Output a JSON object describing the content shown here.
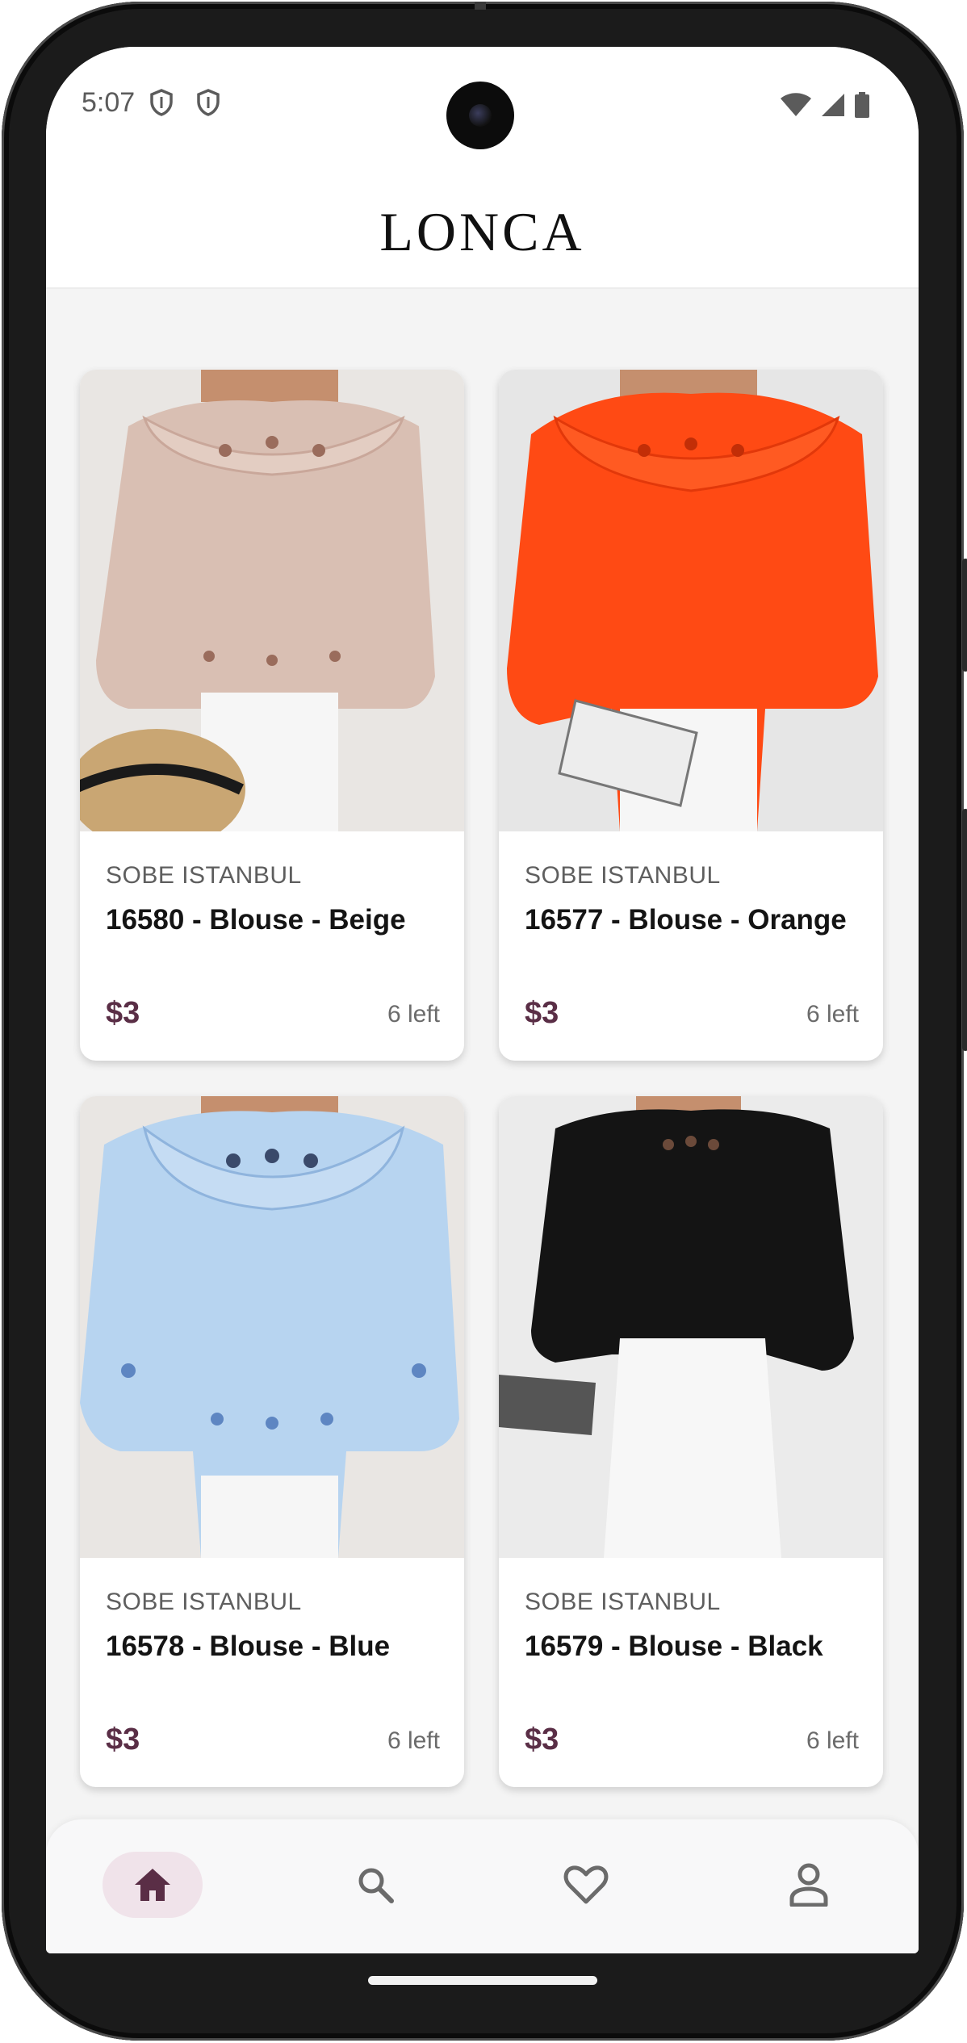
{
  "status_bar": {
    "time": "5:07",
    "icons": [
      "shield-icon",
      "shield-icon",
      "wifi-icon",
      "cellular-icon",
      "battery-icon"
    ]
  },
  "header": {
    "logo": "LONCA"
  },
  "products": [
    {
      "brand": "SOBE ISTANBUL",
      "title": "16580 - Blouse - Beige",
      "price": "$3",
      "stock": "6 left",
      "color": "#d9bfb3"
    },
    {
      "brand": "SOBE ISTANBUL",
      "title": "16577 - Blouse - Orange",
      "price": "$3",
      "stock": "6 left",
      "color": "#ff4a14"
    },
    {
      "brand": "SOBE ISTANBUL",
      "title": "16578 - Blouse - Blue",
      "price": "$3",
      "stock": "6 left",
      "color": "#b7d4f0"
    },
    {
      "brand": "SOBE ISTANBUL",
      "title": "16579 - Blouse - Black",
      "price": "$3",
      "stock": "6 left",
      "color": "#141414"
    }
  ],
  "bottom_nav": {
    "items": [
      {
        "icon": "home-icon",
        "active": true
      },
      {
        "icon": "search-icon",
        "active": false
      },
      {
        "icon": "heart-icon",
        "active": false
      },
      {
        "icon": "profile-icon",
        "active": false
      }
    ]
  },
  "colors": {
    "accent": "#5a2e46",
    "active_nav_bg": "#f0e3ea",
    "screen_bg": "#f4f4f4"
  }
}
